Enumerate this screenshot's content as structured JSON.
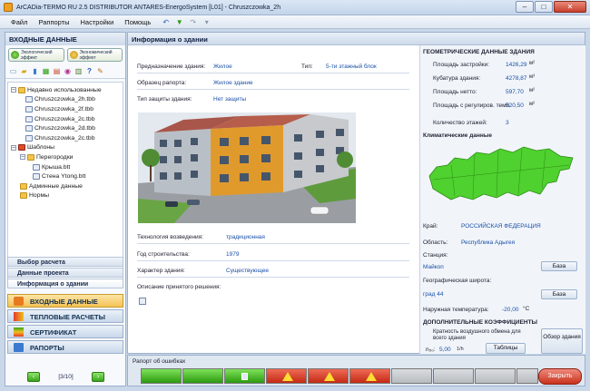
{
  "window": {
    "title": "ArCADia-TERMO RU 2.5 DISTRIBUTOR ANTARES-EnergoSystem [L01] - Chruszczowka_2h"
  },
  "menu": [
    "Файл",
    "Раппорты",
    "Настройки",
    "Помощь"
  ],
  "left": {
    "header": "ВХОДНЫЕ ДАННЫЕ",
    "eco1": "Экологический эффект",
    "eco2": "Экономический эффект",
    "tree": {
      "recent": "Недавно использованные",
      "files": [
        "Chruszczowka_2h.tbb",
        "Chruszczowka_2f.tbb",
        "Chruszczowka_2c.tbb",
        "Chruszczowka_2d.tbb",
        "Chruszczowka_2c.tbb"
      ],
      "templates": "Шаблоны",
      "partitions": "Перегородки",
      "roof": "Крыша.btt",
      "wall": "Стена Ytong.btt",
      "admin": "Админные данные",
      "norms": "Нормы"
    },
    "sections": [
      "Выбор расчета",
      "Данные проекта",
      "Информация о здании"
    ],
    "nav": [
      "ВХОДНЫЕ ДАННЫЕ",
      "ТЕПЛОВЫЕ РАСЧЕТЫ",
      "СЕРТИФИКАТ",
      "РАПОРТЫ"
    ],
    "pager": "[3/10]"
  },
  "main": {
    "header": "Информация о здании",
    "purpose_label": "Предназначение здания:",
    "purpose_value": "Жилое",
    "type_label": "Тип:",
    "type_value": "5-ти этажный блок",
    "sample_label": "Образец рапорта:",
    "sample_value": "Жилое здание",
    "protection_label": "Тип защиты здания:",
    "protection_value": "Нет защиты",
    "tech_label": "Технология возведения:",
    "tech_value": "традиционная",
    "year_label": "Год строительства:",
    "year_value": "1979",
    "character_label": "Характер здания:",
    "character_value": "Существующее",
    "desc_label": "Описание принятого решения:"
  },
  "geometry": {
    "title": "ГЕОМЕТРИЧЕСКИЕ ДАННЫЕ ЗДАНИЯ",
    "area_label": "Площадь застройки:",
    "area_value": "1426,29",
    "area_unit": "м²",
    "volume_label": "Кубатура здания:",
    "volume_value": "4278,87",
    "volume_unit": "м³",
    "net_label": "Площадь нетто:",
    "net_value": "597,70",
    "net_unit": "м²",
    "heated_label": "Площадь с регулиров. темп.",
    "heated_value": "520,50",
    "heated_unit": "м²",
    "floors_label": "Количество этажей:",
    "floors_value": "3"
  },
  "climate": {
    "title": "Климатические данные",
    "country_label": "Край:",
    "country_value": "РОССИЙСКАЯ ФЕДЕРАЦИЯ",
    "region_label": "Область:",
    "region_value": "Республика Адыгея",
    "station_label": "Станция:",
    "station_value": "Майкоп",
    "latitude_label": "Географическая широта:",
    "latitude_value": "град 44",
    "temp_label": "Наружная температура:",
    "temp_value": "-20,00",
    "temp_unit": "°C",
    "base_btn": "База",
    "base_btn2": "База"
  },
  "coeffs": {
    "title": "ДОПОЛНИТЕЛЬНЫЕ КОЭФФИЦИЕНТЫ",
    "air_label": "Кратность воздушного обмена для всего здания",
    "n50_label": "n₅₀:",
    "n50_value": "5,00",
    "n50_unit": "1/h",
    "tables_btn": "Таблицы",
    "survey_btn": "Обзор здания"
  },
  "bottom": {
    "error_label": "Рапорт об ошибках",
    "close_btn": "Закрыть"
  },
  "colors": {
    "accent_blue": "#1a4fa6",
    "status_green": "#2c9a10",
    "status_red": "#c32a14"
  }
}
